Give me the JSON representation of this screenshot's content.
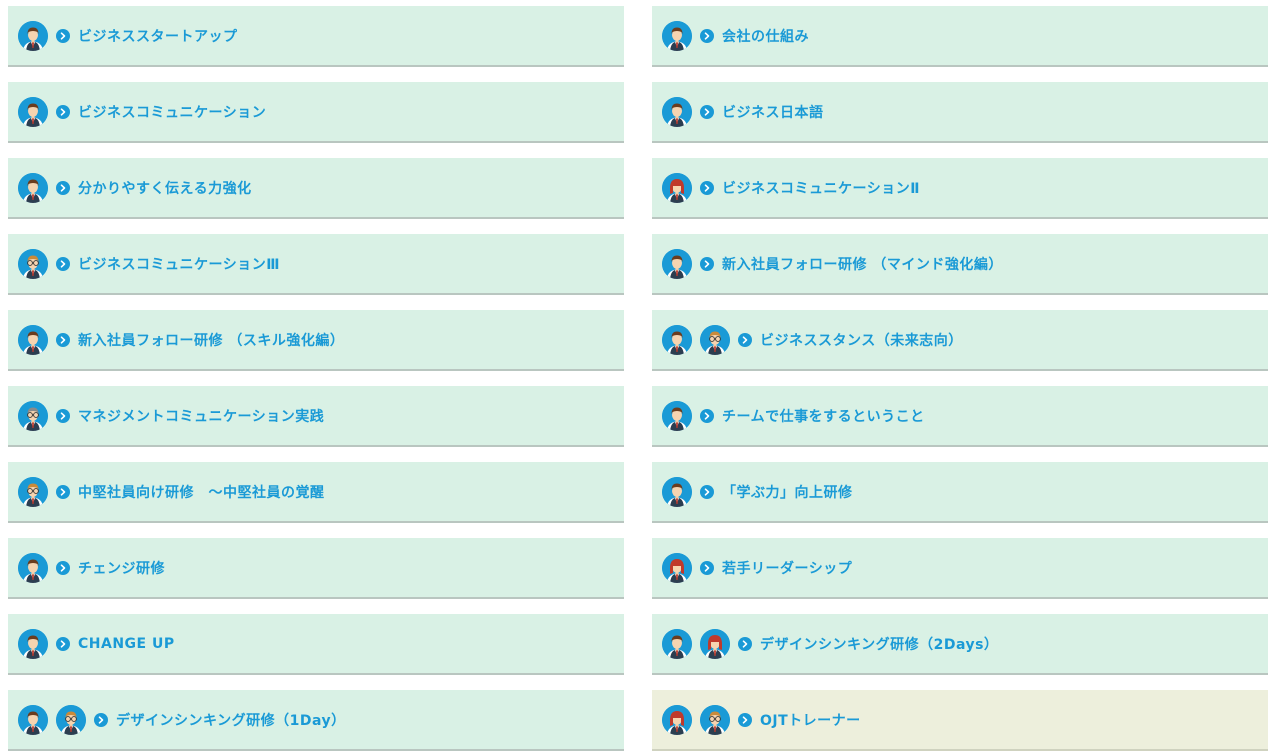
{
  "colors": {
    "accent": "#1a9ad6",
    "card_bg": "#d9f1e5",
    "card_alt_bg": "#edefdc"
  },
  "items": [
    {
      "label": "ビジネススタートアップ",
      "avatars": [
        "man-brown"
      ]
    },
    {
      "label": "会社の仕組み",
      "avatars": [
        "man-brown"
      ]
    },
    {
      "label": "ビジネスコミュニケーション",
      "avatars": [
        "man-brown"
      ]
    },
    {
      "label": "ビジネス日本語",
      "avatars": [
        "man-brown"
      ]
    },
    {
      "label": "分かりやすく伝える力強化",
      "avatars": [
        "man-brown"
      ]
    },
    {
      "label": "ビジネスコミュニケーションⅡ",
      "avatars": [
        "woman-red"
      ]
    },
    {
      "label": "ビジネスコミュニケーションⅢ",
      "avatars": [
        "man-glasses"
      ]
    },
    {
      "label": "新入社員フォロー研修 （マインド強化編）",
      "avatars": [
        "man-brown"
      ]
    },
    {
      "label": "新入社員フォロー研修 （スキル強化編）",
      "avatars": [
        "man-brown"
      ]
    },
    {
      "label": "ビジネススタンス（未来志向）",
      "avatars": [
        "man-brown",
        "man-glasses"
      ]
    },
    {
      "label": "マネジメントコミュニケーション実践",
      "avatars": [
        "man-grey"
      ]
    },
    {
      "label": "チームで仕事をするということ",
      "avatars": [
        "man-brown"
      ]
    },
    {
      "label": "中堅社員向け研修　～中堅社員の覚醒",
      "avatars": [
        "man-glasses"
      ]
    },
    {
      "label": "「学ぶ力」向上研修",
      "avatars": [
        "man-brown"
      ]
    },
    {
      "label": "チェンジ研修",
      "avatars": [
        "man-brown"
      ]
    },
    {
      "label": "若手リーダーシップ",
      "avatars": [
        "woman-red"
      ]
    },
    {
      "label": "CHANGE UP",
      "avatars": [
        "man-brown"
      ]
    },
    {
      "label": "デザインシンキング研修（2Days）",
      "avatars": [
        "man-brown",
        "woman-red"
      ]
    },
    {
      "label": "デザインシンキング研修（1Day）",
      "avatars": [
        "man-brown",
        "man-glasses"
      ]
    },
    {
      "label": "OJTトレーナー",
      "avatars": [
        "woman-red",
        "man-glasses"
      ],
      "alt": true
    }
  ]
}
